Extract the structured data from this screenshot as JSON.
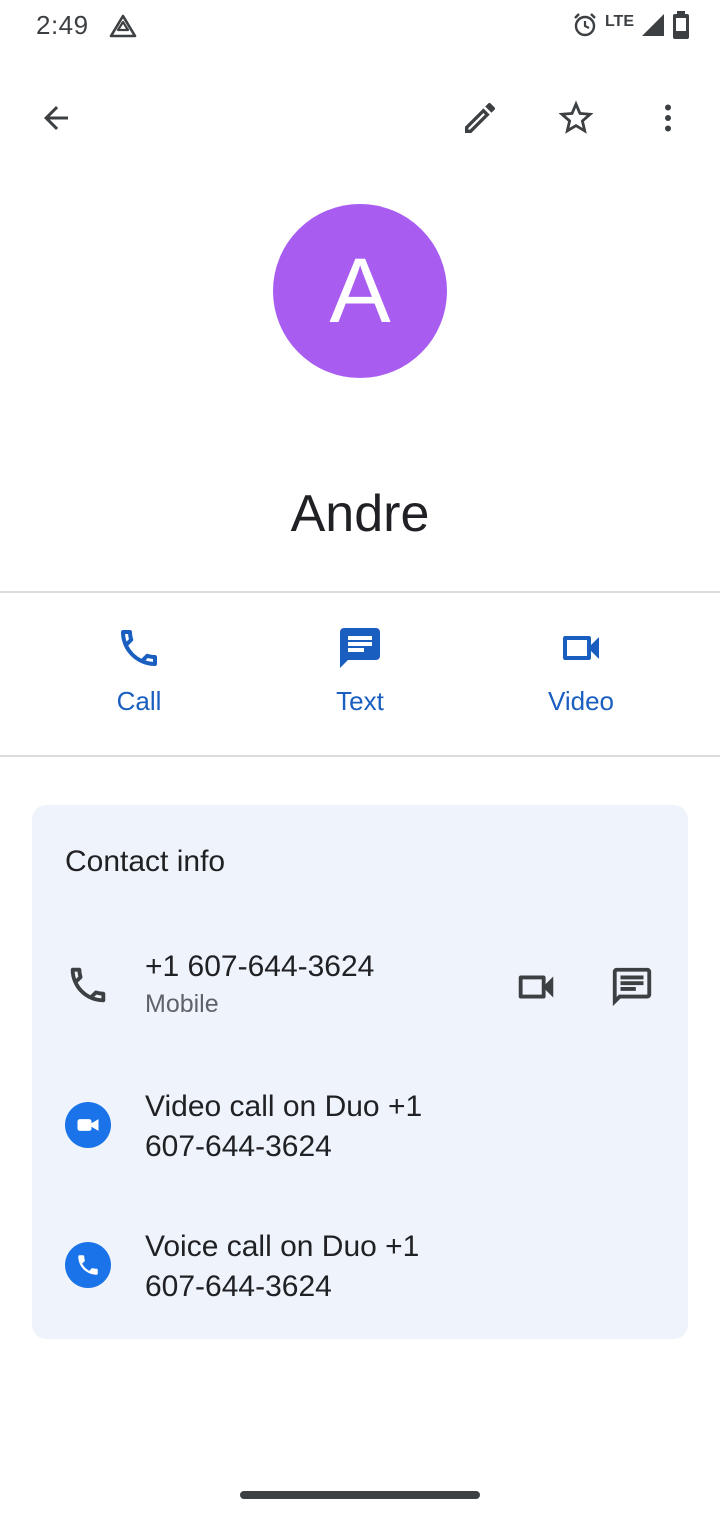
{
  "status_bar": {
    "time": "2:49",
    "network": "LTE",
    "icons": [
      "drive-icon",
      "alarm-icon",
      "signal-icon",
      "battery-icon"
    ]
  },
  "app_bar": {
    "icons": [
      "back-arrow-icon",
      "edit-pencil-icon",
      "star-outline-icon",
      "more-vert-icon"
    ]
  },
  "contact": {
    "initial": "A",
    "name": "Andre",
    "avatar_color": "#a95cf0"
  },
  "actions": [
    {
      "label": "Call",
      "icon": "phone-icon"
    },
    {
      "label": "Text",
      "icon": "message-icon"
    },
    {
      "label": "Video",
      "icon": "videocam-icon"
    }
  ],
  "contact_info": {
    "title": "Contact info",
    "phone": {
      "number": "+1 607-644-3624",
      "type": "Mobile"
    },
    "duo_video": {
      "line1": "Video call on Duo +1",
      "line2": "607-644-3624"
    },
    "duo_voice": {
      "line1": "Voice call on Duo +1",
      "line2": "607-644-3624"
    }
  },
  "colors": {
    "accent": "#1a5fc0",
    "card_bg": "#eff3fb",
    "duo_blue": "#1a73e8"
  }
}
